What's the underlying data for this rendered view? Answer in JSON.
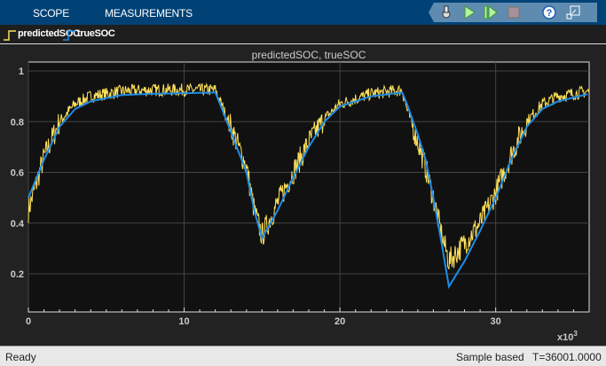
{
  "toolstrip": {
    "tabs": [
      "SCOPE",
      "MEASUREMENTS"
    ],
    "buttons": [
      "settings",
      "run",
      "step-forward",
      "stop",
      "help",
      "undock"
    ]
  },
  "legend": {
    "items": [
      {
        "label": "predictedSOC",
        "color": "#FFE15A"
      },
      {
        "label": "trueSOC",
        "color": "#1E8CE6"
      }
    ]
  },
  "status": {
    "left": "Ready",
    "mode": "Sample based",
    "time": "T=36001.0000"
  },
  "chart_data": {
    "type": "line",
    "title": "predictedSOC, trueSOC",
    "xlabel": "",
    "ylabel": "",
    "x_multiplier": "x10",
    "x_multiplier_exp": "3",
    "xlim": [
      0,
      36
    ],
    "ylim": [
      0.05,
      1.035
    ],
    "xticks": [
      "0",
      "10",
      "20",
      "30"
    ],
    "yticks": [
      "0.2",
      "0.4",
      "0.6",
      "0.8",
      "1"
    ],
    "grid": true,
    "series": [
      {
        "name": "trueSOC",
        "color": "#1E8CE6",
        "x": [
          0,
          1,
          2,
          3,
          4,
          6,
          8,
          10,
          12,
          12.3,
          13,
          14,
          14.5,
          15,
          16,
          17,
          18,
          19,
          20,
          22,
          24,
          24.3,
          25,
          25.5,
          26,
          26.5,
          27,
          28,
          29,
          30,
          31,
          32,
          33,
          34,
          36
        ],
        "y": [
          0.5,
          0.65,
          0.78,
          0.85,
          0.88,
          0.905,
          0.91,
          0.912,
          0.915,
          0.87,
          0.76,
          0.6,
          0.45,
          0.34,
          0.45,
          0.58,
          0.7,
          0.8,
          0.86,
          0.9,
          0.915,
          0.87,
          0.75,
          0.65,
          0.5,
          0.33,
          0.15,
          0.25,
          0.37,
          0.5,
          0.65,
          0.78,
          0.85,
          0.88,
          0.91
        ]
      },
      {
        "name": "predictedSOC",
        "color": "#FFE15A",
        "noise": 0.025,
        "x": [
          0,
          1,
          2,
          3,
          4,
          6,
          8,
          10,
          12,
          12.3,
          13,
          14,
          14.5,
          15,
          16,
          17,
          18,
          19,
          20,
          22,
          24,
          24.3,
          25,
          25.5,
          26,
          26.5,
          27,
          28,
          29,
          30,
          31,
          32,
          33,
          34,
          36
        ],
        "y": [
          0.45,
          0.66,
          0.8,
          0.87,
          0.9,
          0.92,
          0.925,
          0.925,
          0.925,
          0.88,
          0.78,
          0.62,
          0.45,
          0.35,
          0.48,
          0.6,
          0.72,
          0.81,
          0.87,
          0.91,
          0.925,
          0.85,
          0.72,
          0.62,
          0.5,
          0.36,
          0.25,
          0.32,
          0.4,
          0.52,
          0.67,
          0.8,
          0.87,
          0.9,
          0.92
        ]
      }
    ]
  }
}
